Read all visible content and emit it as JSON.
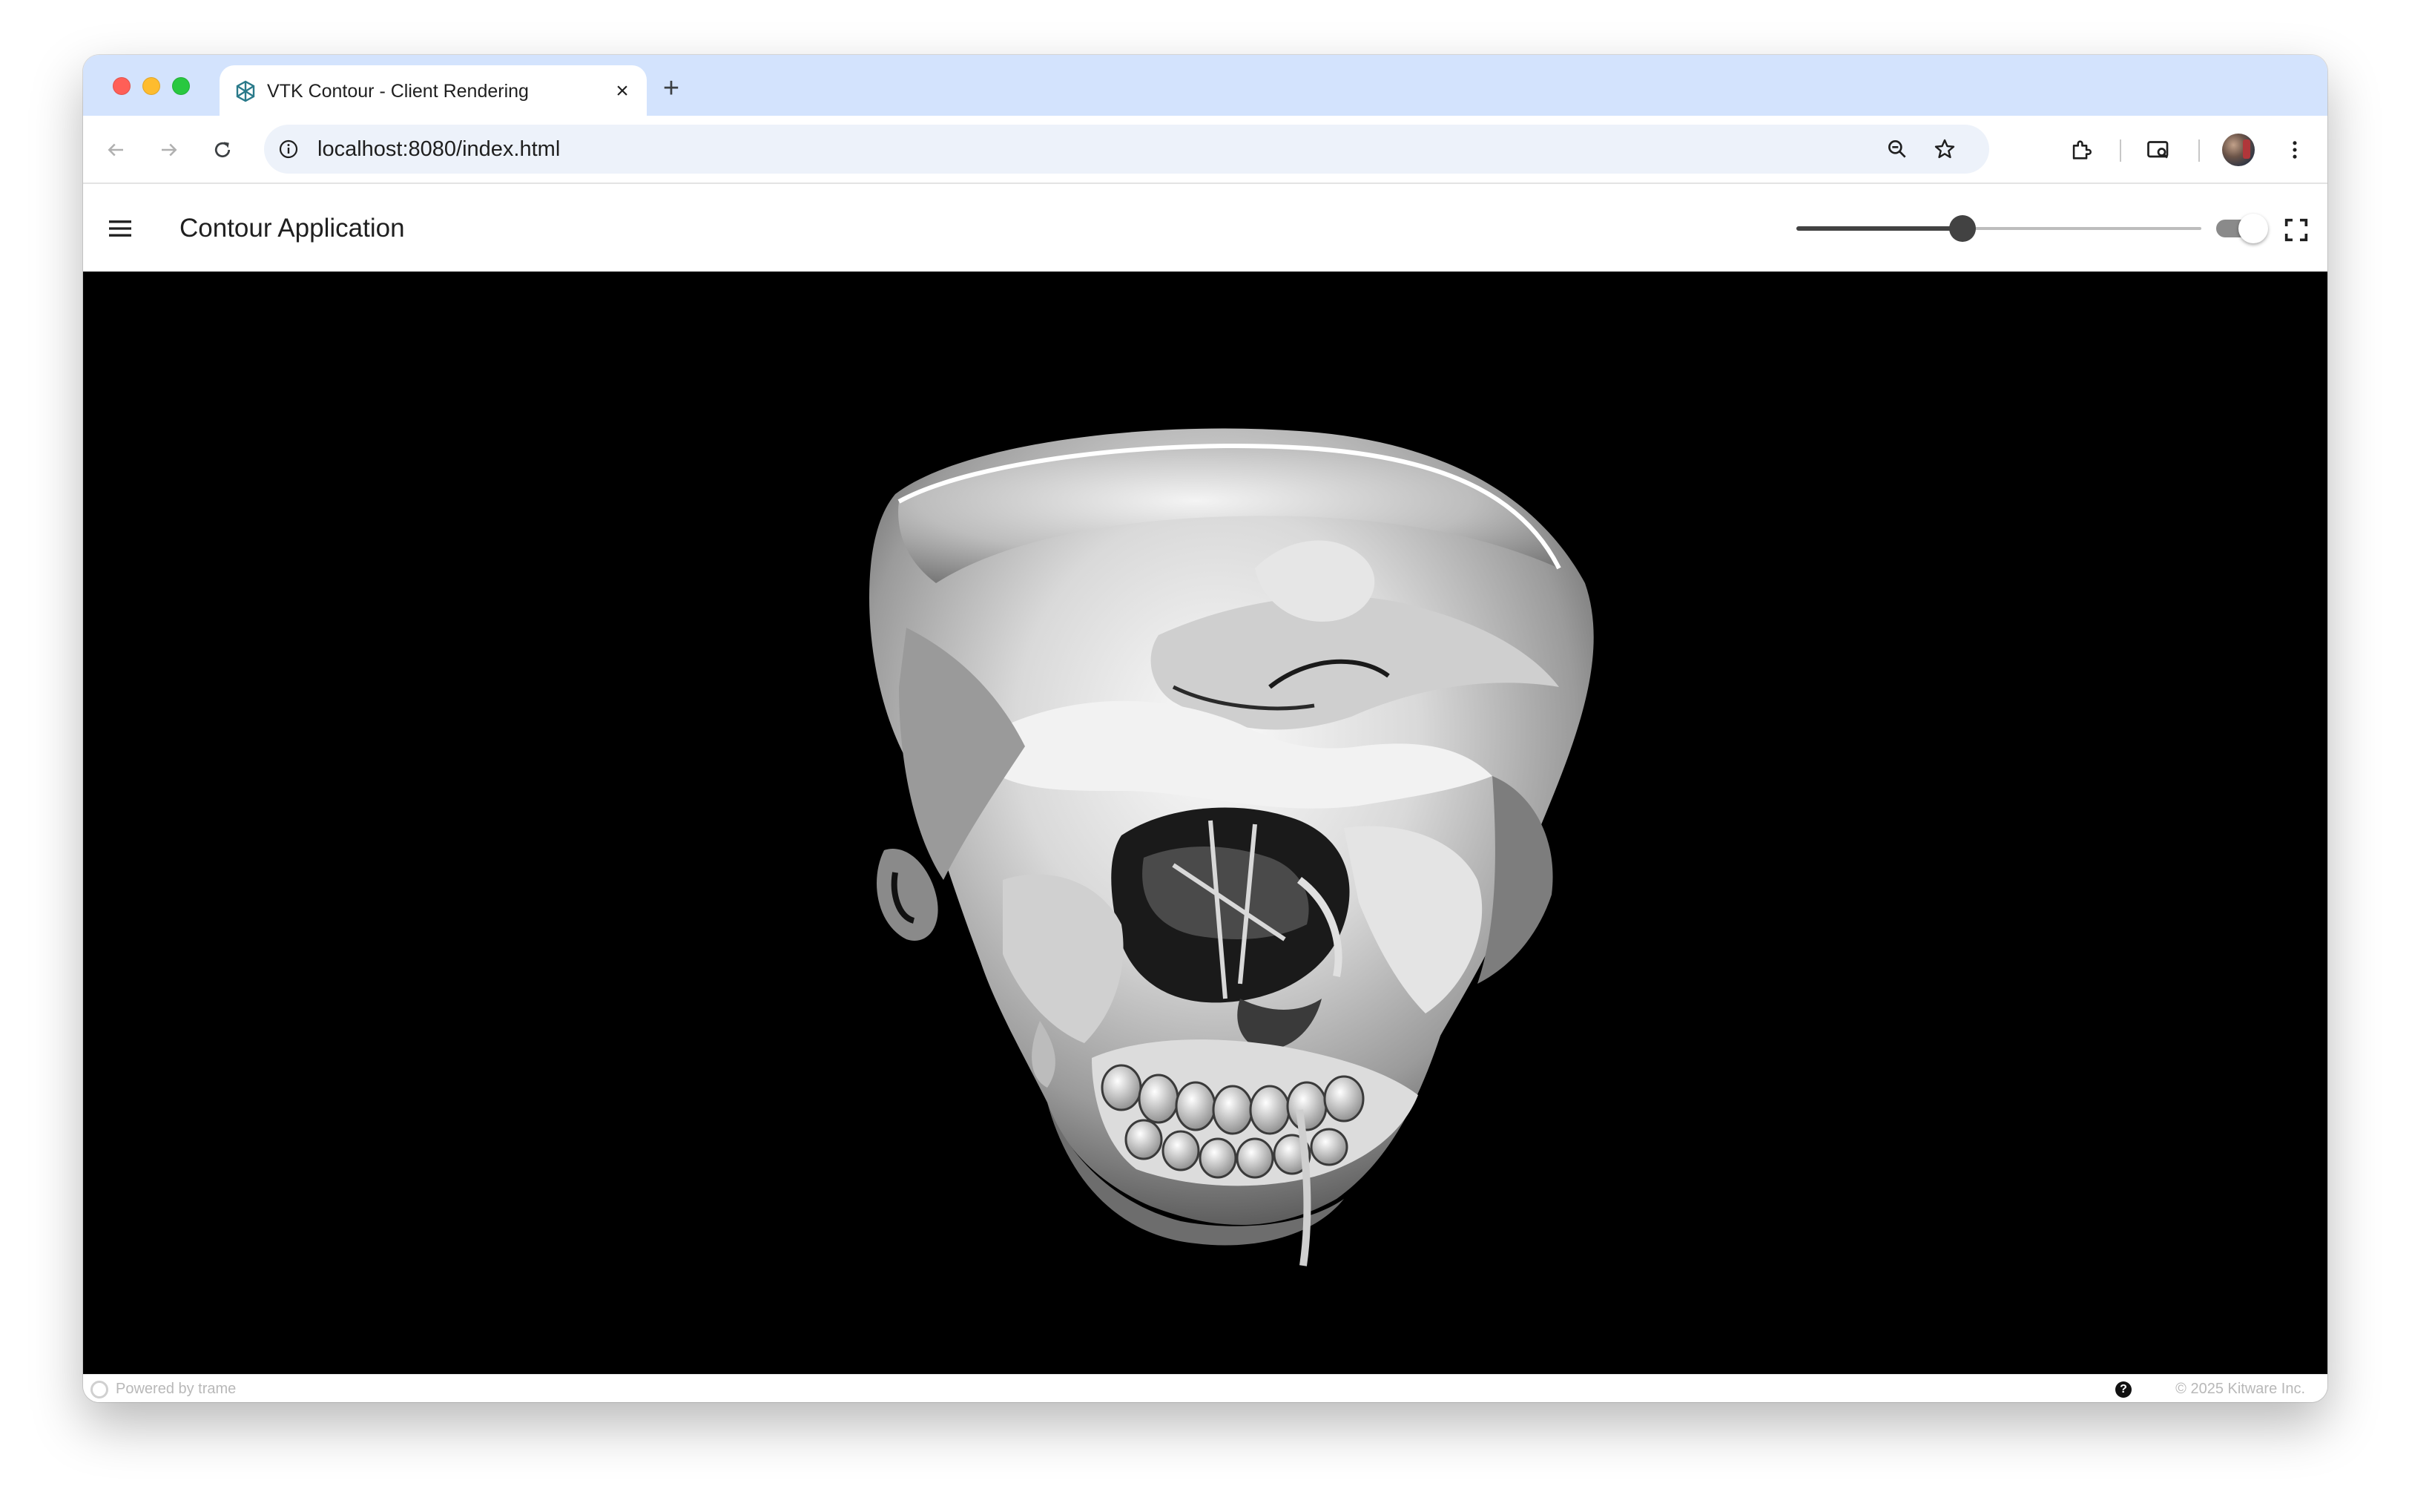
{
  "browser": {
    "tab_title": "VTK Contour - Client Rendering",
    "tab_close": "×",
    "new_tab": "+",
    "url": "localhost:8080/index.html"
  },
  "app": {
    "title": "Contour Application",
    "contour_slider": {
      "value_fraction": 0.41
    },
    "toggle": {
      "on": true
    }
  },
  "viewport": {
    "background": "#000000",
    "content": "skull-isosurface"
  },
  "footer": {
    "left_text": "Powered by trame",
    "help": "?",
    "right_text": "© 2025 Kitware Inc."
  },
  "colors": {
    "tabstrip": "#d3e3fd",
    "omnibox": "#edf2fa",
    "slider": "#424242"
  }
}
